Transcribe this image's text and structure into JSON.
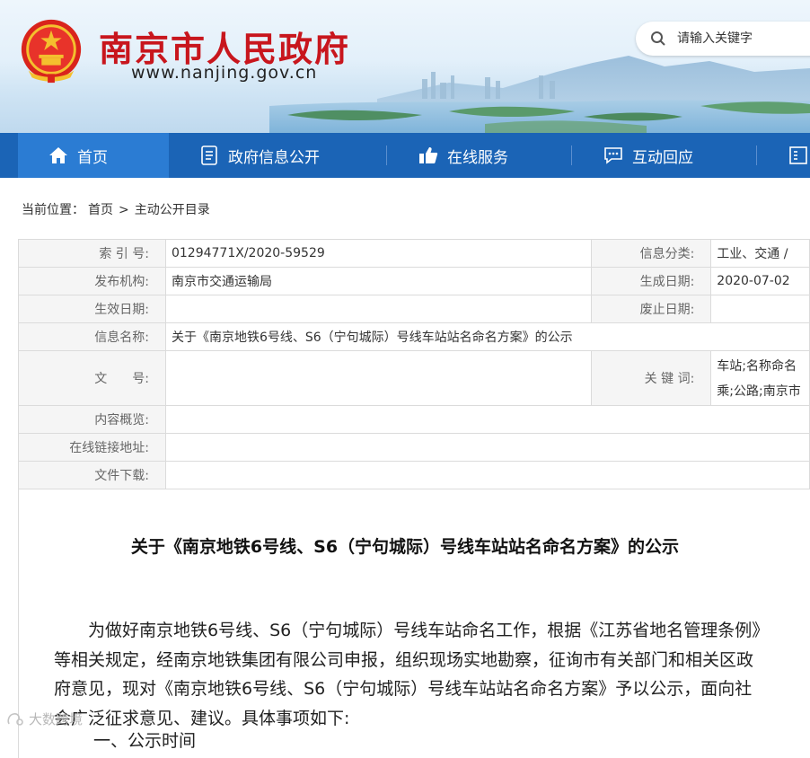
{
  "header": {
    "site_title": "南京市人民政府",
    "site_url": "www.nanjing.gov.cn",
    "search_placeholder": "请输入关键字"
  },
  "nav": {
    "items": [
      {
        "label": "首页",
        "icon": "home-icon",
        "active": true
      },
      {
        "label": "政府信息公开",
        "icon": "document-icon"
      },
      {
        "label": "在线服务",
        "icon": "thumbs-up-icon"
      },
      {
        "label": "互动回应",
        "icon": "chat-icon"
      }
    ]
  },
  "breadcrumb": {
    "prefix": "当前位置：",
    "home": "首页",
    "separator": ">",
    "current": "主动公开目录"
  },
  "meta": {
    "index_label": "索 引 号:",
    "index_value": "01294771X/2020-59529",
    "category_label": "信息分类:",
    "category_value": "工业、交通 /",
    "publisher_label": "发布机构:",
    "publisher_value": "南京市交通运输局",
    "created_label": "生成日期:",
    "created_value": "2020-07-02",
    "effective_label": "生效日期:",
    "effective_value": "",
    "expired_label": "废止日期:",
    "expired_value": "",
    "name_label": "信息名称:",
    "name_value": "关于《南京地铁6号线、S6（宁句城际）号线车站站名命名方案》的公示",
    "docno_label": "文　　号:",
    "docno_value": "",
    "keywords_label": "关 键 词:",
    "keywords_value": "车站;名称命名乘;公路;南京市",
    "summary_label": "内容概览:",
    "summary_value": "",
    "link_label": "在线链接地址:",
    "link_value": "",
    "download_label": "文件下载:",
    "download_value": ""
  },
  "article": {
    "title": "关于《南京地铁6号线、S6（宁句城际）号线车站站名命名方案》的公示",
    "body": "为做好南京地铁6号线、S6（宁句城际）号线车站命名工作，根据《江苏省地名管理条例》等相关规定，经南京地铁集团有限公司申报，组织现场实地勘察，征询市有关部门和相关区政府意见，现对《南京地铁6号线、S6（宁句城际）号线车站站名命名方案》予以公示，面向社会广泛征求意见、建议。具体事项如下:",
    "next_line": "一、公示时间"
  },
  "watermark": {
    "text": "大数跨境"
  },
  "colors": {
    "title_red": "#c8161d",
    "nav_blue": "#1b64b6",
    "nav_active": "#2b7cd3",
    "label_bg": "#f5f5f5"
  }
}
